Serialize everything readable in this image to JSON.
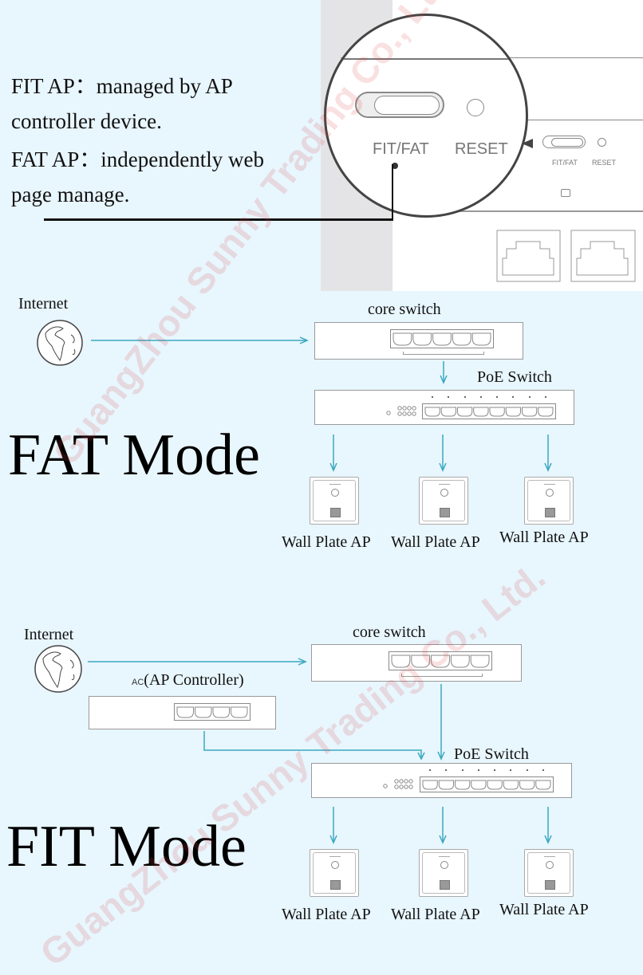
{
  "intro": {
    "fit_line1": "FIT AP：managed by AP",
    "fit_line2": "controller device.",
    "fat_line1": "FAT AP：independently web",
    "fat_line2": "page manage."
  },
  "device_closeup": {
    "zoom_switch_label": "FIT/FAT",
    "zoom_reset_label": "RESET",
    "small_switch_label": "FIT/FAT",
    "small_reset_label": "RESET",
    "switch_position": "left"
  },
  "fat_mode": {
    "title": "FAT Mode",
    "internet_label": "Internet",
    "core_switch_label": "core switch",
    "poe_switch_label": "PoE Switch",
    "core_switch_ports": 5,
    "poe_switch_ports": 8,
    "aps": [
      {
        "label": "Wall Plate AP"
      },
      {
        "label": "Wall Plate AP"
      },
      {
        "label": "Wall Plate AP"
      }
    ]
  },
  "fit_mode": {
    "title": "FIT Mode",
    "internet_label": "Internet",
    "ac_prefix": "AC",
    "ac_label": "(AP Controller)",
    "ac_ports": 4,
    "core_switch_label": "core switch",
    "poe_switch_label": "PoE Switch",
    "core_switch_ports": 5,
    "poe_switch_ports": 8,
    "aps": [
      {
        "label": "Wall Plate AP"
      },
      {
        "label": "Wall Plate AP"
      },
      {
        "label": "Wall Plate AP"
      }
    ]
  },
  "watermark": {
    "text_1": "GuangZhou Sunny Trading Co., Ltd.",
    "text_2": "GuangZhou Sunny Trading Co., Ltd."
  },
  "colors": {
    "background": "#e8f6fd",
    "arrow": "#3aa8c1",
    "device_border": "#9a9a9a"
  }
}
